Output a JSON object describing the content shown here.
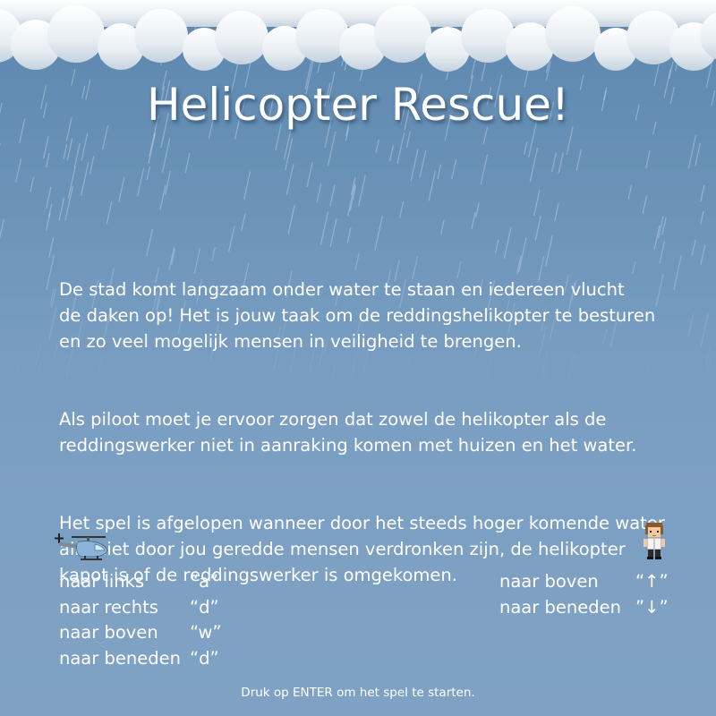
{
  "title": "Helicopter Rescue!",
  "story": {
    "paragraph1": "De stad komt langzaam onder water te staan en iedereen vlucht\nde daken op! Het is jouw taak om de reddingshelikopter te besturen\nen zo veel mogelijk mensen in veiligheid te brengen.",
    "paragraph2": "Als piloot moet je ervoor zorgen dat zowel de helikopter als de\nreddingswerker niet in aanraking komen met huizen en het water.",
    "paragraph3": "Het spel is afgelopen wanneer door het steeds hoger komende water\nalle niet door jou geredde mensen verdronken zijn, de helikopter\nkapot is of de reddingswerker is omgekomen."
  },
  "helicopter_controls": [
    {
      "action": "naar links",
      "key": "“a”"
    },
    {
      "action": "naar rechts",
      "key": "“d”"
    },
    {
      "action": "naar boven",
      "key": "“w”"
    },
    {
      "action": "naar beneden",
      "key": "“d”"
    }
  ],
  "rescuer_controls": [
    {
      "action": "naar boven",
      "key": "“↑”"
    },
    {
      "action": "naar beneden",
      "key": "”↓”"
    }
  ],
  "start_prompt": "Druk op ENTER om het spel te starten.",
  "icons": {
    "helicopter": "helicopter-icon",
    "rescuer": "rescue-worker-icon"
  },
  "colors": {
    "sky_top": "#5b86ad",
    "sky_bottom": "#7fa2c4",
    "text": "#ffffff",
    "helicopter_body": "#8ab4d8"
  }
}
